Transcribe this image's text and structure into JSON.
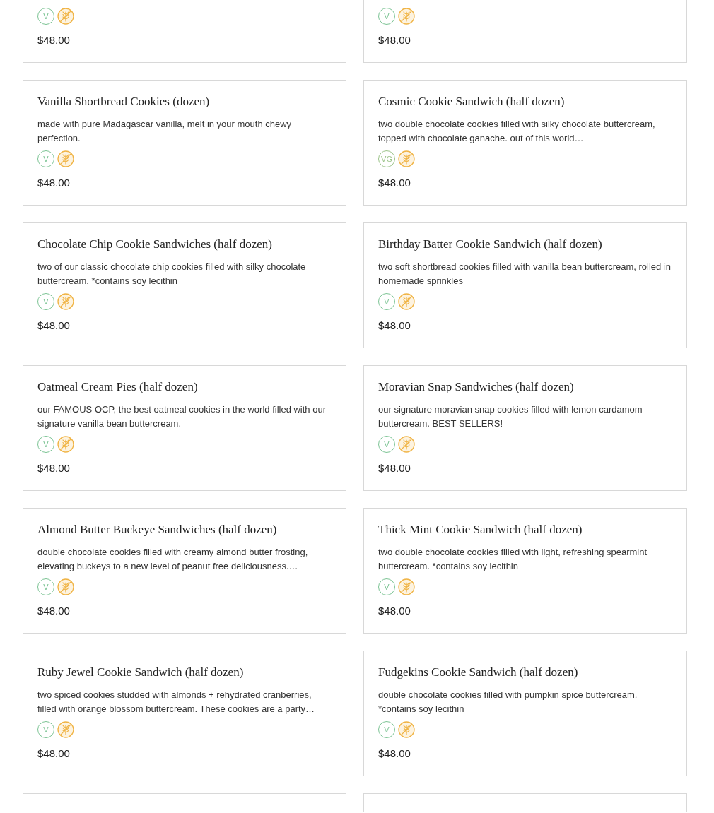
{
  "products": [
    {
      "badges": [
        {
          "kind": "vegetarian",
          "label": "V"
        },
        {
          "kind": "gluten-free"
        }
      ],
      "price": "$48.00"
    },
    {
      "badges": [
        {
          "kind": "vegetarian",
          "label": "V"
        },
        {
          "kind": "gluten-free"
        }
      ],
      "price": "$48.00"
    },
    {
      "title": "Vanilla Shortbread Cookies (dozen)",
      "description": "made with pure Madagascar vanilla, melt in your mouth chewy perfection.",
      "badges": [
        {
          "kind": "vegetarian",
          "label": "V"
        },
        {
          "kind": "gluten-free"
        }
      ],
      "price": "$48.00"
    },
    {
      "title": "Cosmic Cookie Sandwich (half dozen)",
      "description": "two double chocolate cookies filled with silky chocolate buttercream, topped with chocolate ganache. out of this world…",
      "badges": [
        {
          "kind": "vegan",
          "label": "VG"
        },
        {
          "kind": "gluten-free"
        }
      ],
      "price": "$48.00"
    },
    {
      "title": "Chocolate Chip Cookie Sandwiches (half dozen)",
      "description": "two of our classic chocolate chip cookies filled with silky chocolate buttercream. *contains soy lecithin",
      "badges": [
        {
          "kind": "vegetarian",
          "label": "V"
        },
        {
          "kind": "gluten-free"
        }
      ],
      "price": "$48.00"
    },
    {
      "title": "Birthday Batter Cookie Sandwich (half dozen)",
      "description": "two soft shortbread cookies filled with vanilla bean buttercream, rolled in homemade sprinkles",
      "badges": [
        {
          "kind": "vegetarian",
          "label": "V"
        },
        {
          "kind": "gluten-free"
        }
      ],
      "price": "$48.00"
    },
    {
      "title": "Oatmeal Cream Pies (half dozen)",
      "description": "our FAMOUS OCP, the best oatmeal cookies in the world filled with our signature vanilla bean buttercream.",
      "badges": [
        {
          "kind": "vegetarian",
          "label": "V"
        },
        {
          "kind": "gluten-free"
        }
      ],
      "price": "$48.00"
    },
    {
      "title": "Moravian Snap Sandwiches (half dozen)",
      "description": "our signature moravian snap cookies filled with lemon cardamom buttercream. BEST SELLERS!",
      "badges": [
        {
          "kind": "vegetarian",
          "label": "V"
        },
        {
          "kind": "gluten-free"
        }
      ],
      "price": "$48.00"
    },
    {
      "title": "Almond Butter Buckeye Sandwiches (half dozen)",
      "description": "double chocolate cookies filled with creamy almond butter frosting, elevating buckeys to a new level of peanut free deliciousness.…",
      "badges": [
        {
          "kind": "vegetarian",
          "label": "V"
        },
        {
          "kind": "gluten-free"
        }
      ],
      "price": "$48.00"
    },
    {
      "title": "Thick Mint Cookie Sandwich (half dozen)",
      "description": "two double chocolate cookies filled with light, refreshing spearmint buttercream. *contains soy lecithin",
      "badges": [
        {
          "kind": "vegetarian",
          "label": "V"
        },
        {
          "kind": "gluten-free"
        }
      ],
      "price": "$48.00"
    },
    {
      "title": "Ruby Jewel Cookie Sandwich (half dozen)",
      "description": "two spiced cookies studded with almonds + rehydrated cranberries, filled with orange blossom buttercream. These cookies are a party…",
      "badges": [
        {
          "kind": "vegetarian",
          "label": "V"
        },
        {
          "kind": "gluten-free"
        }
      ],
      "price": "$48.00"
    },
    {
      "title": "Fudgekins Cookie Sandwich (half dozen)",
      "description": "double chocolate cookies filled with pumpkin spice buttercream. *contains soy lecithin",
      "badges": [
        {
          "kind": "vegetarian",
          "label": "V"
        },
        {
          "kind": "gluten-free"
        }
      ],
      "price": "$48.00"
    },
    {
      "kind": "cut-off"
    },
    {
      "kind": "cut-off"
    }
  ]
}
